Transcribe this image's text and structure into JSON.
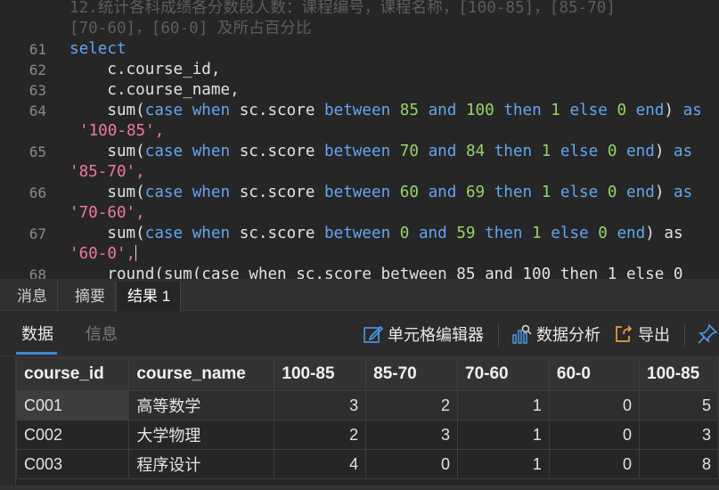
{
  "editor": {
    "comment_line1": "12.统计各科成绩各分数段人数：课程编号，课程名称，[100-85]，[85-70]",
    "comment_line2": "[70-60]，[60-0] 及所占百分比",
    "line_numbers": [
      "61",
      "62",
      "63",
      "64",
      "65",
      "66",
      "67",
      "68"
    ],
    "code": {
      "select": "select",
      "col1": "    c.course_id,",
      "col2": "    c.course_name,",
      "sum": "sum(",
      "case": "case",
      "when": "when",
      "score": "sc.score",
      "between": "between",
      "and": "and",
      "then": "then",
      "else": "else",
      "end": "end",
      "as": "as",
      "one": "1",
      "zero": "0",
      "rows": [
        {
          "lo": "85",
          "hi": "100",
          "alias": "'100-85',"
        },
        {
          "lo": "70",
          "hi": "84",
          "alias": "'85-70',"
        },
        {
          "lo": "60",
          "hi": "69",
          "alias": "'70-60',"
        },
        {
          "lo": "0",
          "hi": "59",
          "alias": "'60-0',"
        }
      ],
      "last_line": "    round(sum(case when sc.score between 85 and 100 then 1 else 0"
    }
  },
  "tabs": [
    "消息",
    "摘要",
    "结果 1"
  ],
  "subtabs": {
    "data": "数据",
    "info": "信息"
  },
  "toolbar": {
    "cell_editor": "单元格编辑器",
    "data_analysis": "数据分析",
    "export": "导出"
  },
  "table": {
    "columns": [
      "course_id",
      "course_name",
      "100-85",
      "85-70",
      "70-60",
      "60-0",
      "100-85"
    ],
    "rows": [
      [
        "C001",
        "高等数学",
        "3",
        "2",
        "1",
        "0",
        "5"
      ],
      [
        "C002",
        "大学物理",
        "2",
        "3",
        "1",
        "0",
        "3"
      ],
      [
        "C003",
        "程序设计",
        "4",
        "0",
        "1",
        "0",
        "8"
      ]
    ]
  }
}
